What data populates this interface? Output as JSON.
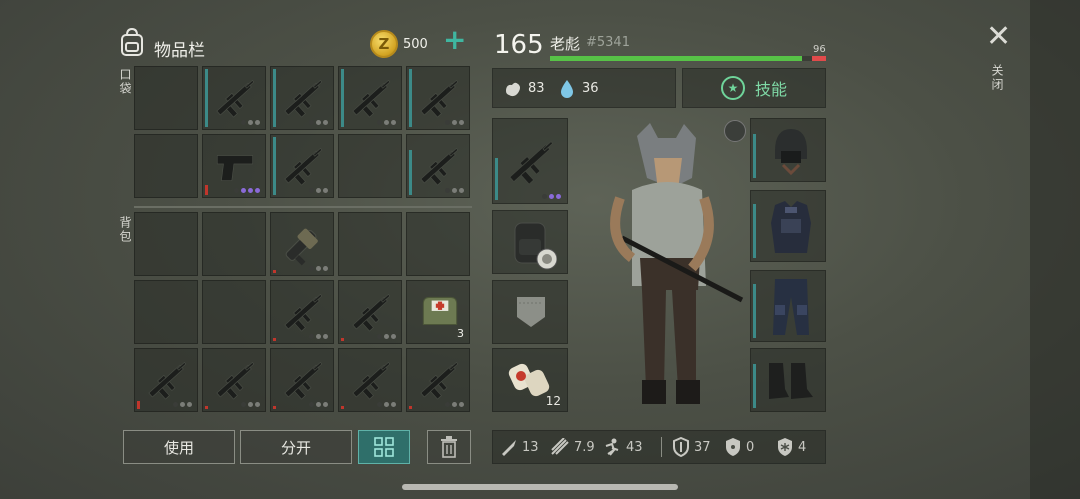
{
  "header": {
    "title": "物品栏",
    "coins": "500"
  },
  "labels": {
    "pocket": "口袋",
    "backpack": "背包",
    "close": "关闭"
  },
  "buttons": {
    "use": "使用",
    "split": "分开"
  },
  "pocket_slots": [
    {
      "item": "empty"
    },
    {
      "item": "rifle-icon",
      "bar": "teal",
      "bar_h": 58
    },
    {
      "item": "rifle-icon",
      "bar": "teal",
      "bar_h": 58
    },
    {
      "item": "rifle-icon",
      "bar": "teal",
      "bar_h": 58
    },
    {
      "item": "rifle-icon",
      "bar": "teal",
      "bar_h": 58
    },
    {
      "item": "empty"
    },
    {
      "item": "pistol-icon",
      "bar": "red",
      "bar_h": 10,
      "rarity": "purple"
    },
    {
      "item": "rifle-icon",
      "bar": "teal",
      "bar_h": 58
    },
    {
      "item": "empty"
    },
    {
      "item": "rifle-icon",
      "bar": "teal",
      "bar_h": 45
    }
  ],
  "backpack_slots": [
    {
      "item": "empty"
    },
    {
      "item": "empty"
    },
    {
      "item": "grenade-launcher-icon",
      "bar": "red",
      "bar_h": 3
    },
    {
      "item": "empty"
    },
    {
      "item": "empty"
    },
    {
      "item": "empty"
    },
    {
      "item": "empty"
    },
    {
      "item": "rifle-icon",
      "bar": "red",
      "bar_h": 3
    },
    {
      "item": "rifle-icon",
      "bar": "red",
      "bar_h": 3
    },
    {
      "item": "medkit-bag-icon",
      "count": "3"
    },
    {
      "item": "rifle-icon",
      "bar": "red",
      "bar_h": 8
    },
    {
      "item": "rifle-icon",
      "bar": "red",
      "bar_h": 3
    },
    {
      "item": "rifle-icon",
      "bar": "red",
      "bar_h": 3
    },
    {
      "item": "rifle-icon",
      "bar": "red",
      "bar_h": 3
    },
    {
      "item": "rifle-icon",
      "bar": "red",
      "bar_h": 3
    }
  ],
  "player": {
    "level": "165",
    "name": "老彪",
    "id": "#5341",
    "hp": "96",
    "hp_fraction": 0.96
  },
  "vitals": {
    "food": "83",
    "water": "36"
  },
  "skills_label": "技能",
  "equipment": {
    "weapon": "rifle-icon",
    "backpack": "backpack-icon",
    "pocket": "pocket-icon",
    "consumable": {
      "item": "bandage-icon",
      "count": "12"
    },
    "helmet": "helmet-icon",
    "armor": "vest-icon",
    "pants": "pants-icon",
    "boots": "boots-icon"
  },
  "bottom_stats": {
    "melee": "13",
    "ranged": "7.9",
    "speed": "43",
    "armor": "37",
    "radiation": "0",
    "cold": "4"
  },
  "colors": {
    "accent": "#3fb6a0",
    "hp": "#57c247",
    "hp_low": "#e04b4b",
    "skill": "#7fd9a6"
  }
}
